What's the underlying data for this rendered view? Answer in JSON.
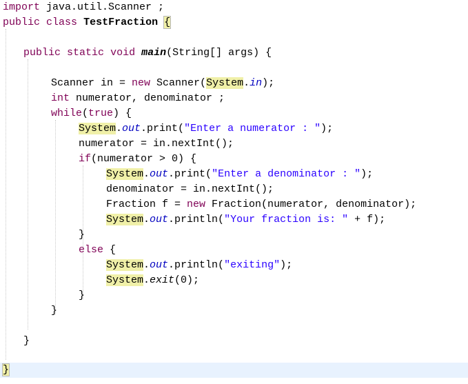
{
  "code": {
    "l1": {
      "kw": "import",
      "rest": " java.util.Scanner ;"
    },
    "l2": {
      "kw1": "public",
      "kw2": "class",
      "name": "TestFraction",
      "brace": "{"
    },
    "l3": {
      "kw1": "public",
      "kw2": "static",
      "kw3": "void",
      "method": "main",
      "params": "(String[] args) {"
    },
    "l4": {
      "a": "Scanner in = ",
      "kw": "new",
      "b": " Scanner(",
      "sys": "System",
      "dot": ".",
      "fld": "in",
      "c": ");"
    },
    "l5": {
      "kw": "int",
      "rest": " numerator, denominator ;"
    },
    "l6": {
      "kw": "while",
      "open": "(",
      "kw2": "true",
      "close": ") {"
    },
    "l7": {
      "sys": "System",
      "dot": ".",
      "fld": "out",
      "a": ".print(",
      "str": "\"Enter a numerator : \"",
      "c": ");"
    },
    "l8": {
      "text": "numerator = in.nextInt();"
    },
    "l9": {
      "kw": "if",
      "rest": "(numerator > 0) {"
    },
    "l10": {
      "sys": "System",
      "dot": ".",
      "fld": "out",
      "a": ".print(",
      "str": "\"Enter a denominator : \"",
      "c": ");"
    },
    "l11": {
      "text": "denominator = in.nextInt();"
    },
    "l12": {
      "a": "Fraction f = ",
      "kw": "new",
      "b": " Fraction(numerator, denominator);"
    },
    "l13": {
      "sys": "System",
      "dot": ".",
      "fld": "out",
      "a": ".println(",
      "str": "\"Your fraction is: \"",
      "c": " + f);"
    },
    "l14": {
      "text": "}"
    },
    "l15": {
      "kw": "else",
      "rest": " {"
    },
    "l16": {
      "sys": "System",
      "dot": ".",
      "fld": "out",
      "a": ".println(",
      "str": "\"exiting\"",
      "c": ");"
    },
    "l17": {
      "sys": "System",
      "dot": ".",
      "fld": "exit",
      "c": "(0);"
    },
    "l18": {
      "text": "}"
    },
    "l19": {
      "text": "}"
    },
    "l20": {
      "text": "}"
    },
    "l21": {
      "brace": "}"
    }
  }
}
